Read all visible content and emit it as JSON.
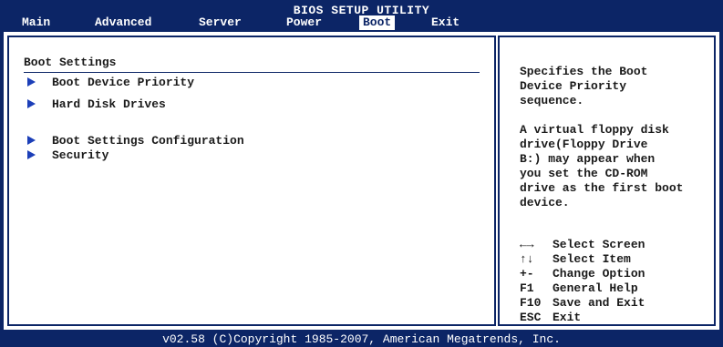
{
  "title": "BIOS SETUP UTILITY",
  "tabs": [
    {
      "label": "Main"
    },
    {
      "label": "Advanced"
    },
    {
      "label": "Server"
    },
    {
      "label": "Power"
    },
    {
      "label": "Boot"
    },
    {
      "label": "Exit"
    }
  ],
  "active_tab": "Boot",
  "section_title": "Boot Settings",
  "menu_items": [
    {
      "label": "Boot Device Priority"
    },
    {
      "label": "Hard Disk Drives"
    },
    {
      "label": "Boot Settings Configuration"
    },
    {
      "label": "Security"
    }
  ],
  "help": {
    "line1": "Specifies the Boot",
    "line2": "Device Priority",
    "line3": "sequence.",
    "line4": "A virtual floppy disk",
    "line5": "drive(Floppy Drive",
    "line6": "B:) may appear when",
    "line7": "you set the CD-ROM",
    "line8": "drive as the first boot",
    "line9": "device."
  },
  "keys": [
    {
      "key": "←→",
      "action": "Select Screen"
    },
    {
      "key": "↑↓",
      "action": "Select Item"
    },
    {
      "key": "+-",
      "action": "Change Option"
    },
    {
      "key": "F1",
      "action": "General Help"
    },
    {
      "key": "F10",
      "action": "Save and Exit"
    },
    {
      "key": "ESC",
      "action": "Exit"
    }
  ],
  "footer": "v02.58 (C)Copyright 1985-2007, American Megatrends, Inc.",
  "colors": {
    "background": "#0c2566",
    "panel": "#ffffff",
    "arrow": "#1c3fb8"
  }
}
